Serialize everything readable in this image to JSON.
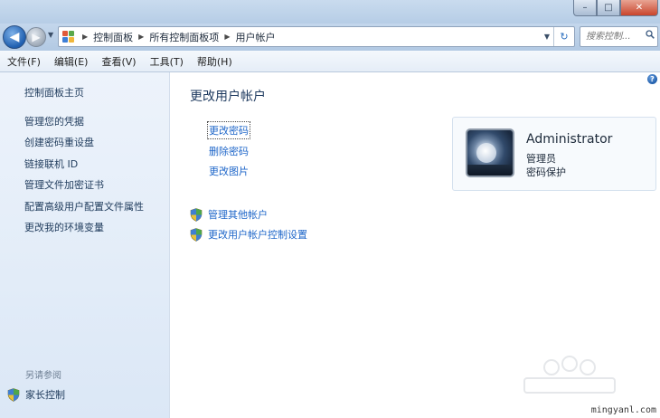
{
  "window": {
    "caption": {
      "minimize": "–",
      "maximize": "□",
      "close": "✕"
    }
  },
  "nav": {
    "back_glyph": "◀",
    "forward_glyph": "▶",
    "breadcrumbs": [
      "控制面板",
      "所有控制面板项",
      "用户帐户"
    ],
    "search_placeholder": "搜索控制..."
  },
  "menu": [
    "文件(F)",
    "编辑(E)",
    "查看(V)",
    "工具(T)",
    "帮助(H)"
  ],
  "sidebar": {
    "home": "控制面板主页",
    "items": [
      "管理您的凭据",
      "创建密码重设盘",
      "链接联机 ID",
      "管理文件加密证书",
      "配置高级用户配置文件属性",
      "更改我的环境变量"
    ],
    "see_also_title": "另请参阅",
    "see_also_items": [
      "家长控制"
    ]
  },
  "main": {
    "title": "更改用户帐户",
    "tasks": [
      "更改密码",
      "删除密码",
      "更改图片"
    ],
    "admin_tasks": [
      "管理其他帐户",
      "更改用户帐户控制设置"
    ]
  },
  "user": {
    "name": "Administrator",
    "role": "管理员",
    "status": "密码保护"
  },
  "watermark": "mingyanl.com",
  "colors": {
    "link": "#1e66c9",
    "sidebar_link": "#1f3b5c",
    "title": "#1e3a5f"
  }
}
